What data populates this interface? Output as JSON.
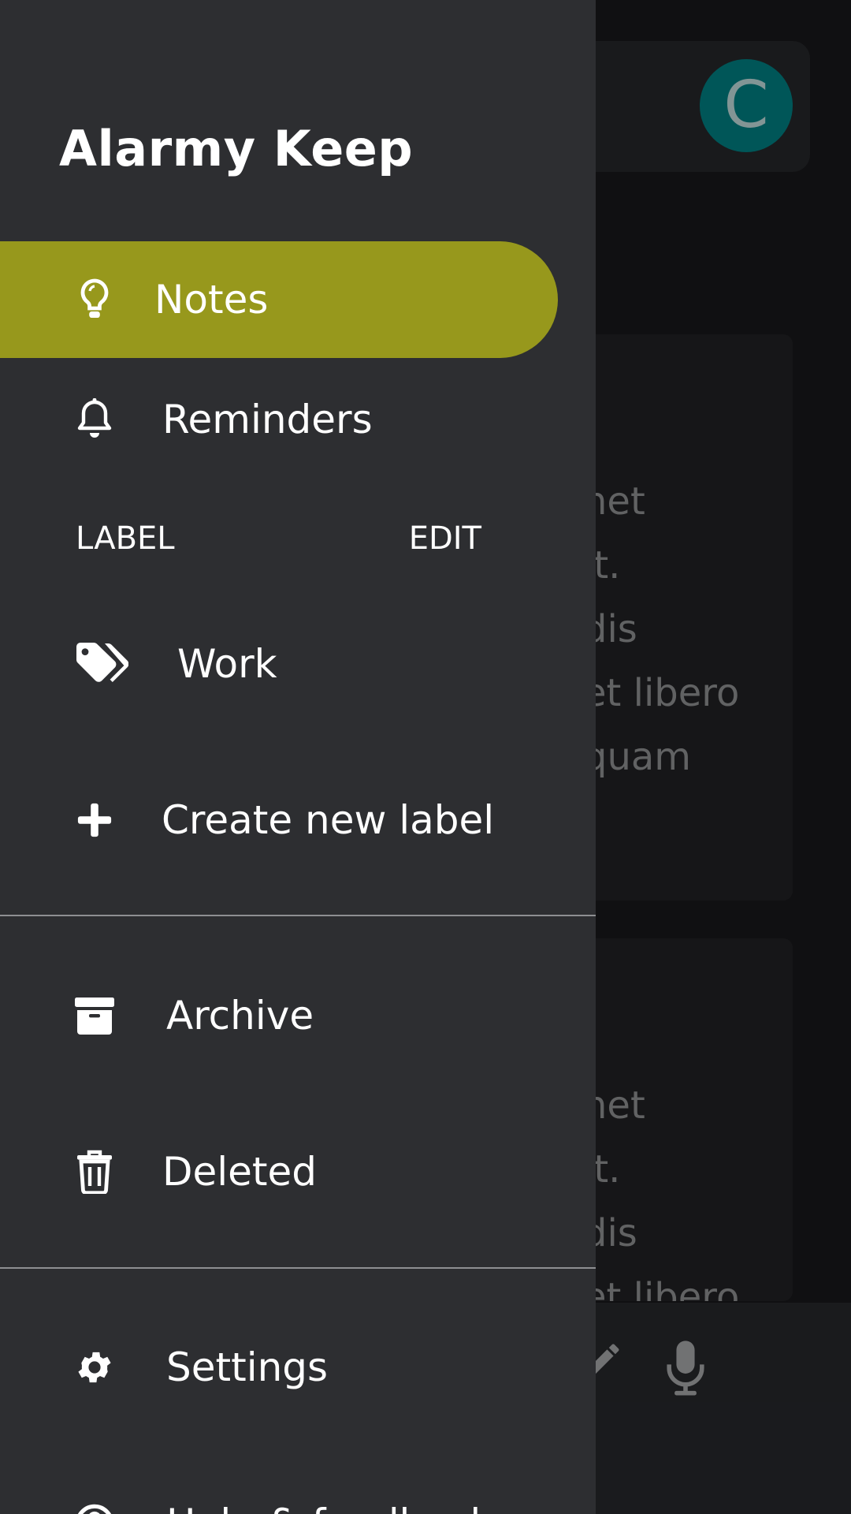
{
  "app": {
    "title": "Alarmy Keep"
  },
  "avatar": {
    "initial": "C",
    "color": "#006a6c"
  },
  "drawer": {
    "active_color": "#97981c",
    "items": [
      {
        "label": "Notes",
        "icon": "lightbulb-icon",
        "active": true
      },
      {
        "label": "Reminders",
        "icon": "bell-icon"
      }
    ],
    "labels_section": {
      "title": "LABEL",
      "edit": "EDIT"
    },
    "labels": [
      {
        "label": "Work",
        "icon": "tags-icon"
      }
    ],
    "create_label": {
      "label": "Create new label",
      "icon": "plus-icon"
    },
    "secondary": [
      {
        "label": "Archive",
        "icon": "archive-icon"
      },
      {
        "label": "Deleted",
        "icon": "trash-icon"
      }
    ],
    "footer": [
      {
        "label": "Settings",
        "icon": "gear-icon"
      },
      {
        "label": "Help & feedback",
        "icon": "help-icon"
      }
    ]
  },
  "background": {
    "card1_lines": [
      "net",
      "it.",
      "dis",
      "et libero",
      "quam"
    ],
    "card2_lines": [
      "net",
      "it.",
      "dis",
      "et libero"
    ],
    "bottom_icons": [
      "pencil-icon",
      "microphone-icon"
    ]
  }
}
